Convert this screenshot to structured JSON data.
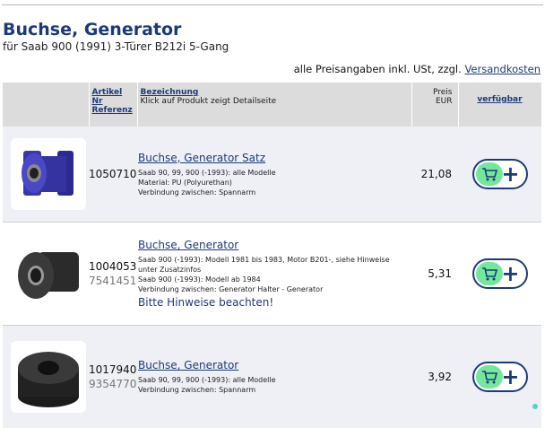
{
  "header": {
    "title": "Buchse, Generator",
    "subtitle": "für Saab 900 (1991) 3-Türer B212i 5-Gang"
  },
  "price_note": {
    "text": "alle Preisangaben inkl. USt, zzgl.",
    "link": "Versandkosten"
  },
  "table": {
    "headers": {
      "col_article_1": "Artikel",
      "col_article_2": "Nr",
      "col_article_3": "Referenz",
      "col_desc_1": "Bezeichnung",
      "col_desc_2": "Klick auf Produkt zeigt Detailseite",
      "col_price_1": "Preis",
      "col_price_2": "EUR",
      "col_avail": "verfügbar"
    },
    "rows": [
      {
        "article": "1050710",
        "reference": "",
        "name": "Buchse, Generator Satz",
        "lines": [
          "Saab 90, 99, 900 (-1993): alle Modelle",
          "Material: PU (Polyurethan)",
          "Verbindung zwischen: Spannarm"
        ],
        "hint": "",
        "price": "21,08",
        "image": "purple-polyurethane-bushing"
      },
      {
        "article": "1004053",
        "reference": "7541451",
        "name": "Buchse, Generator",
        "lines": [
          "Saab 900 (-1993): Modell 1981 bis 1983, Motor B201-, siehe Hinweise",
          "unter Zusatzinfos",
          "Saab 900 (-1993): Modell ab 1984",
          "Verbindung zwischen: Generator Halter - Generator"
        ],
        "hint": "Bitte Hinweise beachten!",
        "price": "5,31",
        "image": "black-rubber-bushing-tall"
      },
      {
        "article": "1017940",
        "reference": "9354770",
        "name": "Buchse, Generator",
        "lines": [
          "Saab 90, 99, 900 (-1993): alle Modelle",
          "Verbindung zwischen: Spannarm"
        ],
        "hint": "",
        "price": "3,92",
        "image": "black-rubber-bushing-round"
      }
    ]
  },
  "icons": {
    "cart": "shopping-cart-icon",
    "plus": "plus-icon"
  },
  "colors": {
    "brand_blue": "#1c3a78",
    "cart_green": "#74e89a",
    "row_tint": "#eef0f6",
    "header_gray": "#dcdcdc"
  }
}
